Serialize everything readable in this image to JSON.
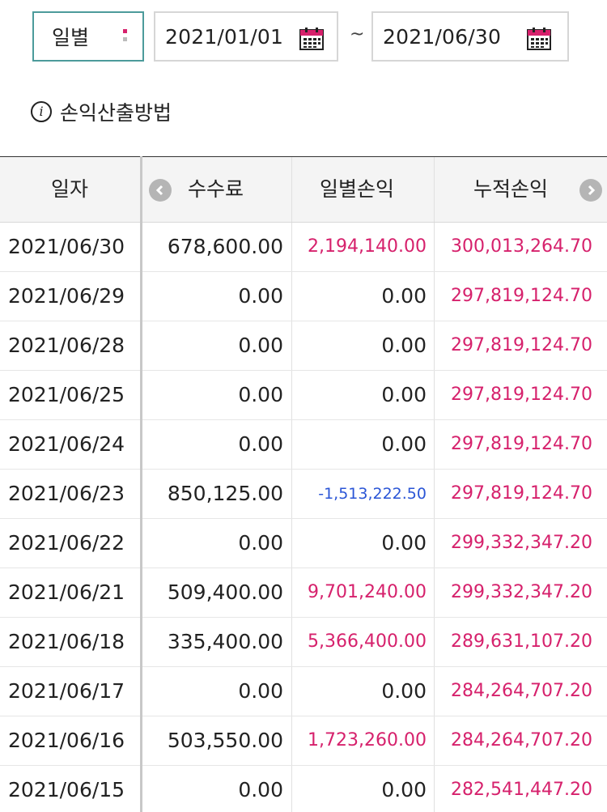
{
  "filter": {
    "period_label": "일별",
    "start_date": "2021/01/01",
    "separator": "~",
    "end_date": "2021/06/30",
    "accent_color": "#d6216c"
  },
  "method_link": {
    "icon": "info-icon",
    "label": "손익산출방법"
  },
  "table": {
    "headers": [
      "일자",
      "수수료",
      "일별손익",
      "누적손익"
    ],
    "rows": [
      {
        "date": "2021/06/30",
        "fee": "678,600.00",
        "daily": "2,194,140.00",
        "cumulative": "300,013,264.70"
      },
      {
        "date": "2021/06/29",
        "fee": "0.00",
        "daily": "0.00",
        "cumulative": "297,819,124.70"
      },
      {
        "date": "2021/06/28",
        "fee": "0.00",
        "daily": "0.00",
        "cumulative": "297,819,124.70"
      },
      {
        "date": "2021/06/25",
        "fee": "0.00",
        "daily": "0.00",
        "cumulative": "297,819,124.70"
      },
      {
        "date": "2021/06/24",
        "fee": "0.00",
        "daily": "0.00",
        "cumulative": "297,819,124.70"
      },
      {
        "date": "2021/06/23",
        "fee": "850,125.00",
        "daily": "-1,513,222.50",
        "cumulative": "297,819,124.70"
      },
      {
        "date": "2021/06/22",
        "fee": "0.00",
        "daily": "0.00",
        "cumulative": "299,332,347.20"
      },
      {
        "date": "2021/06/21",
        "fee": "509,400.00",
        "daily": "9,701,240.00",
        "cumulative": "299,332,347.20"
      },
      {
        "date": "2021/06/18",
        "fee": "335,400.00",
        "daily": "5,366,400.00",
        "cumulative": "289,631,107.20"
      },
      {
        "date": "2021/06/17",
        "fee": "0.00",
        "daily": "0.00",
        "cumulative": "284,264,707.20"
      },
      {
        "date": "2021/06/16",
        "fee": "503,550.00",
        "daily": "1,723,260.00",
        "cumulative": "284,264,707.20"
      },
      {
        "date": "2021/06/15",
        "fee": "0.00",
        "daily": "0.00",
        "cumulative": "282,541,447.20"
      }
    ],
    "positive_color": "#d6216c",
    "negative_color": "#2a55d6"
  }
}
